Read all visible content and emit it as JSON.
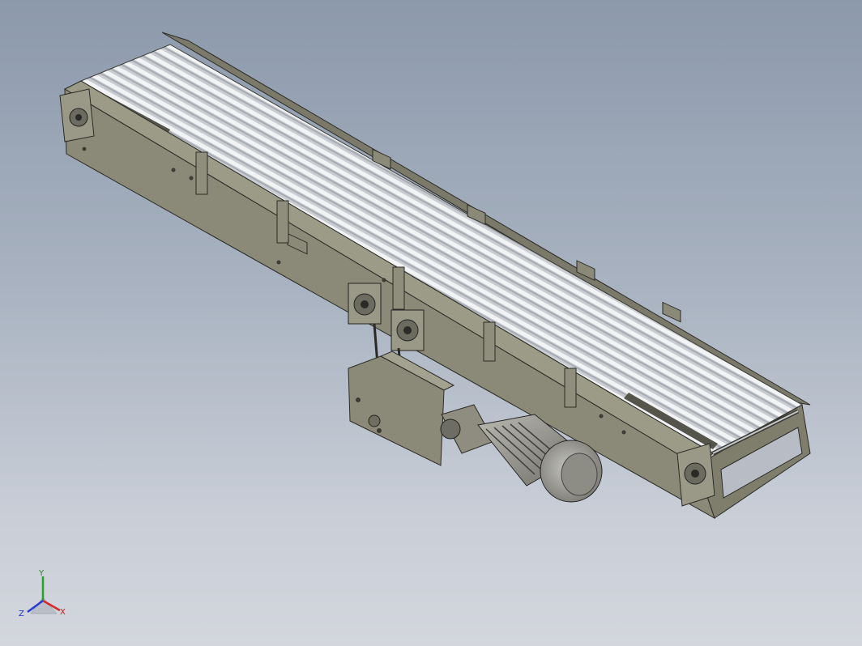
{
  "view": {
    "background_top": "#8c99ab",
    "background_bottom": "#d3d6dd"
  },
  "model": {
    "part": "belt-conveyor",
    "frame_color": "#8b8a78",
    "roller_color": "#dfe2e6",
    "motor_color": "#9a9a92"
  },
  "triad": {
    "x_label": "X",
    "y_label": "Y",
    "z_label": "Z",
    "x_color": "#d42a2a",
    "y_color": "#2aa02a",
    "z_color": "#2a3ad4"
  }
}
